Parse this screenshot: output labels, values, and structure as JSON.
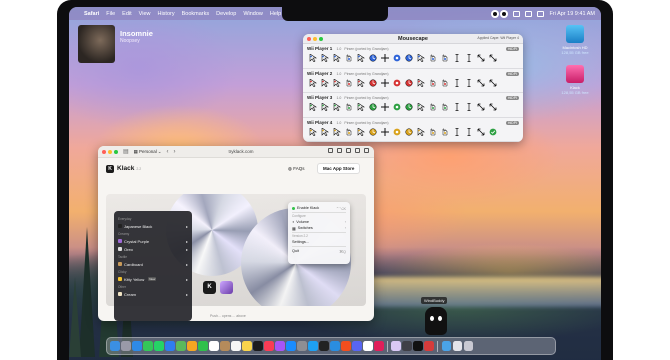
{
  "menubar": {
    "apple_glyph": "",
    "app_name": "Safari",
    "items": [
      "File",
      "Edit",
      "View",
      "History",
      "Bookmarks",
      "Develop",
      "Window",
      "Help"
    ],
    "clock": "Fri Apr 19  9:41 AM"
  },
  "now_playing": {
    "title": "Insomnie",
    "artist": "Noopsey"
  },
  "desktop_icons": [
    {
      "label": "Macintosh HD",
      "sublabel": "128,55 GB free",
      "color": "#2aa8e6"
    },
    {
      "label": "Klack",
      "sublabel": "128,55 GB free",
      "color": "#e8408c"
    }
  ],
  "mousecape": {
    "title": "Mousecape",
    "applied": "Applied Cape: Wii Player 4",
    "rows": [
      {
        "name": "Wii Player 1",
        "version": "1.0",
        "author": "Pirsen (ported by Grandjam)",
        "badge": "HiDPI",
        "accent": "#2d63d8"
      },
      {
        "name": "Wii Player 2",
        "version": "1.0",
        "author": "Pirsen (ported by Grandjam)",
        "badge": "HiDPI",
        "accent": "#d63333"
      },
      {
        "name": "Wii Player 3",
        "version": "1.0",
        "author": "Pirsen (ported by Grandjam)",
        "badge": "HiDPI",
        "accent": "#2ea043"
      },
      {
        "name": "Wii Player 4",
        "version": "1.0",
        "author": "Pirsen (ported by Grandjam)",
        "badge": "HiDPI",
        "accent": "#d9a21c"
      }
    ]
  },
  "safari": {
    "profile": "Personal",
    "url": "tryklack.com",
    "page": {
      "app_name": "Klack",
      "version": "2.2",
      "faq": "FAQs",
      "store_button": "Mac App Store",
      "footer_note": "Push... opens ... above"
    },
    "dropdown": {
      "sections": [
        {
          "header": "Everyday",
          "items": [
            {
              "label": "Japanese Black",
              "color": "#222222"
            }
          ]
        },
        {
          "header": "Creamy",
          "items": [
            {
              "label": "Crystal Purple",
              "color": "#a06ad8"
            },
            {
              "label": "Oreo",
              "color": "#dddddd"
            }
          ]
        },
        {
          "header": "Tactile",
          "items": [
            {
              "label": "Cardboard",
              "color": "#c89a5a"
            }
          ]
        },
        {
          "header": "Clicky",
          "items": [
            {
              "label": "Kitty Yellow",
              "color": "#f4c430",
              "badge": "New"
            }
          ]
        },
        {
          "header": "Other",
          "items": [
            {
              "label": "Cream",
              "color": "#f1e4c4"
            }
          ]
        }
      ]
    },
    "context_menu": {
      "enable": "Enable Klack",
      "enable_shortcut": "⌃⌥K",
      "section": "Configure",
      "volume": "Volume",
      "switches": "Switches",
      "about_section": "Version 2.2",
      "settings": "Settings...",
      "quit": "Quit",
      "quit_shortcut": "⌘Q"
    }
  },
  "deskbuddy": {
    "label": "WindBuddy"
  },
  "dock": {
    "apps": [
      {
        "name": "finder-icon",
        "color": "#3b8fe3"
      },
      {
        "name": "launchpad-icon",
        "color": "#9a9aa8"
      },
      {
        "name": "safari-icon",
        "color": "#2e8ae6"
      },
      {
        "name": "messages-icon",
        "color": "#34c759"
      },
      {
        "name": "whatsapp-icon",
        "color": "#25d366"
      },
      {
        "name": "mail-icon",
        "color": "#2f7df0"
      },
      {
        "name": "maps-icon",
        "color": "#5cb85c"
      },
      {
        "name": "photos-icon",
        "color": "#f5a623"
      },
      {
        "name": "facetime-icon",
        "color": "#30c04c"
      },
      {
        "name": "calendar-icon",
        "color": "#ffffff"
      },
      {
        "name": "contacts-icon",
        "color": "#b58b5b"
      },
      {
        "name": "reminders-icon",
        "color": "#f7f7f7"
      },
      {
        "name": "notes-icon",
        "color": "#f8d44c"
      },
      {
        "name": "tv-icon",
        "color": "#1c1c1e"
      },
      {
        "name": "music-icon",
        "color": "#fa3c55"
      },
      {
        "name": "podcasts-icon",
        "color": "#a855f7"
      },
      {
        "name": "appstore-icon",
        "color": "#1a8cff"
      },
      {
        "name": "settings-icon",
        "color": "#8e8e93"
      },
      {
        "name": "xcode-icon",
        "color": "#1ea0f2"
      },
      {
        "name": "terminal-icon",
        "color": "#222222"
      },
      {
        "name": "vscode-icon",
        "color": "#2a8de0"
      },
      {
        "name": "figma-icon",
        "color": "#f24e1e"
      },
      {
        "name": "discord-icon",
        "color": "#5865f2"
      },
      {
        "name": "notion-icon",
        "color": "#ffffff"
      },
      {
        "name": "slack-icon",
        "color": "#e01e5a"
      }
    ],
    "recent": [
      {
        "name": "klack-dock-icon",
        "color": "#d9c8f5"
      },
      {
        "name": "mousecape-dock-icon",
        "color": "#3f3f46"
      },
      {
        "name": "deskbuddy-dock-icon",
        "color": "#111111"
      },
      {
        "name": "mario-dock-icon",
        "color": "#d63b3b"
      }
    ],
    "right": [
      {
        "name": "downloads-folder-icon",
        "color": "#4aa3e8"
      },
      {
        "name": "documents-icon",
        "color": "#e4e4ea"
      },
      {
        "name": "trash-icon",
        "color": "#c9c9d2"
      }
    ]
  }
}
